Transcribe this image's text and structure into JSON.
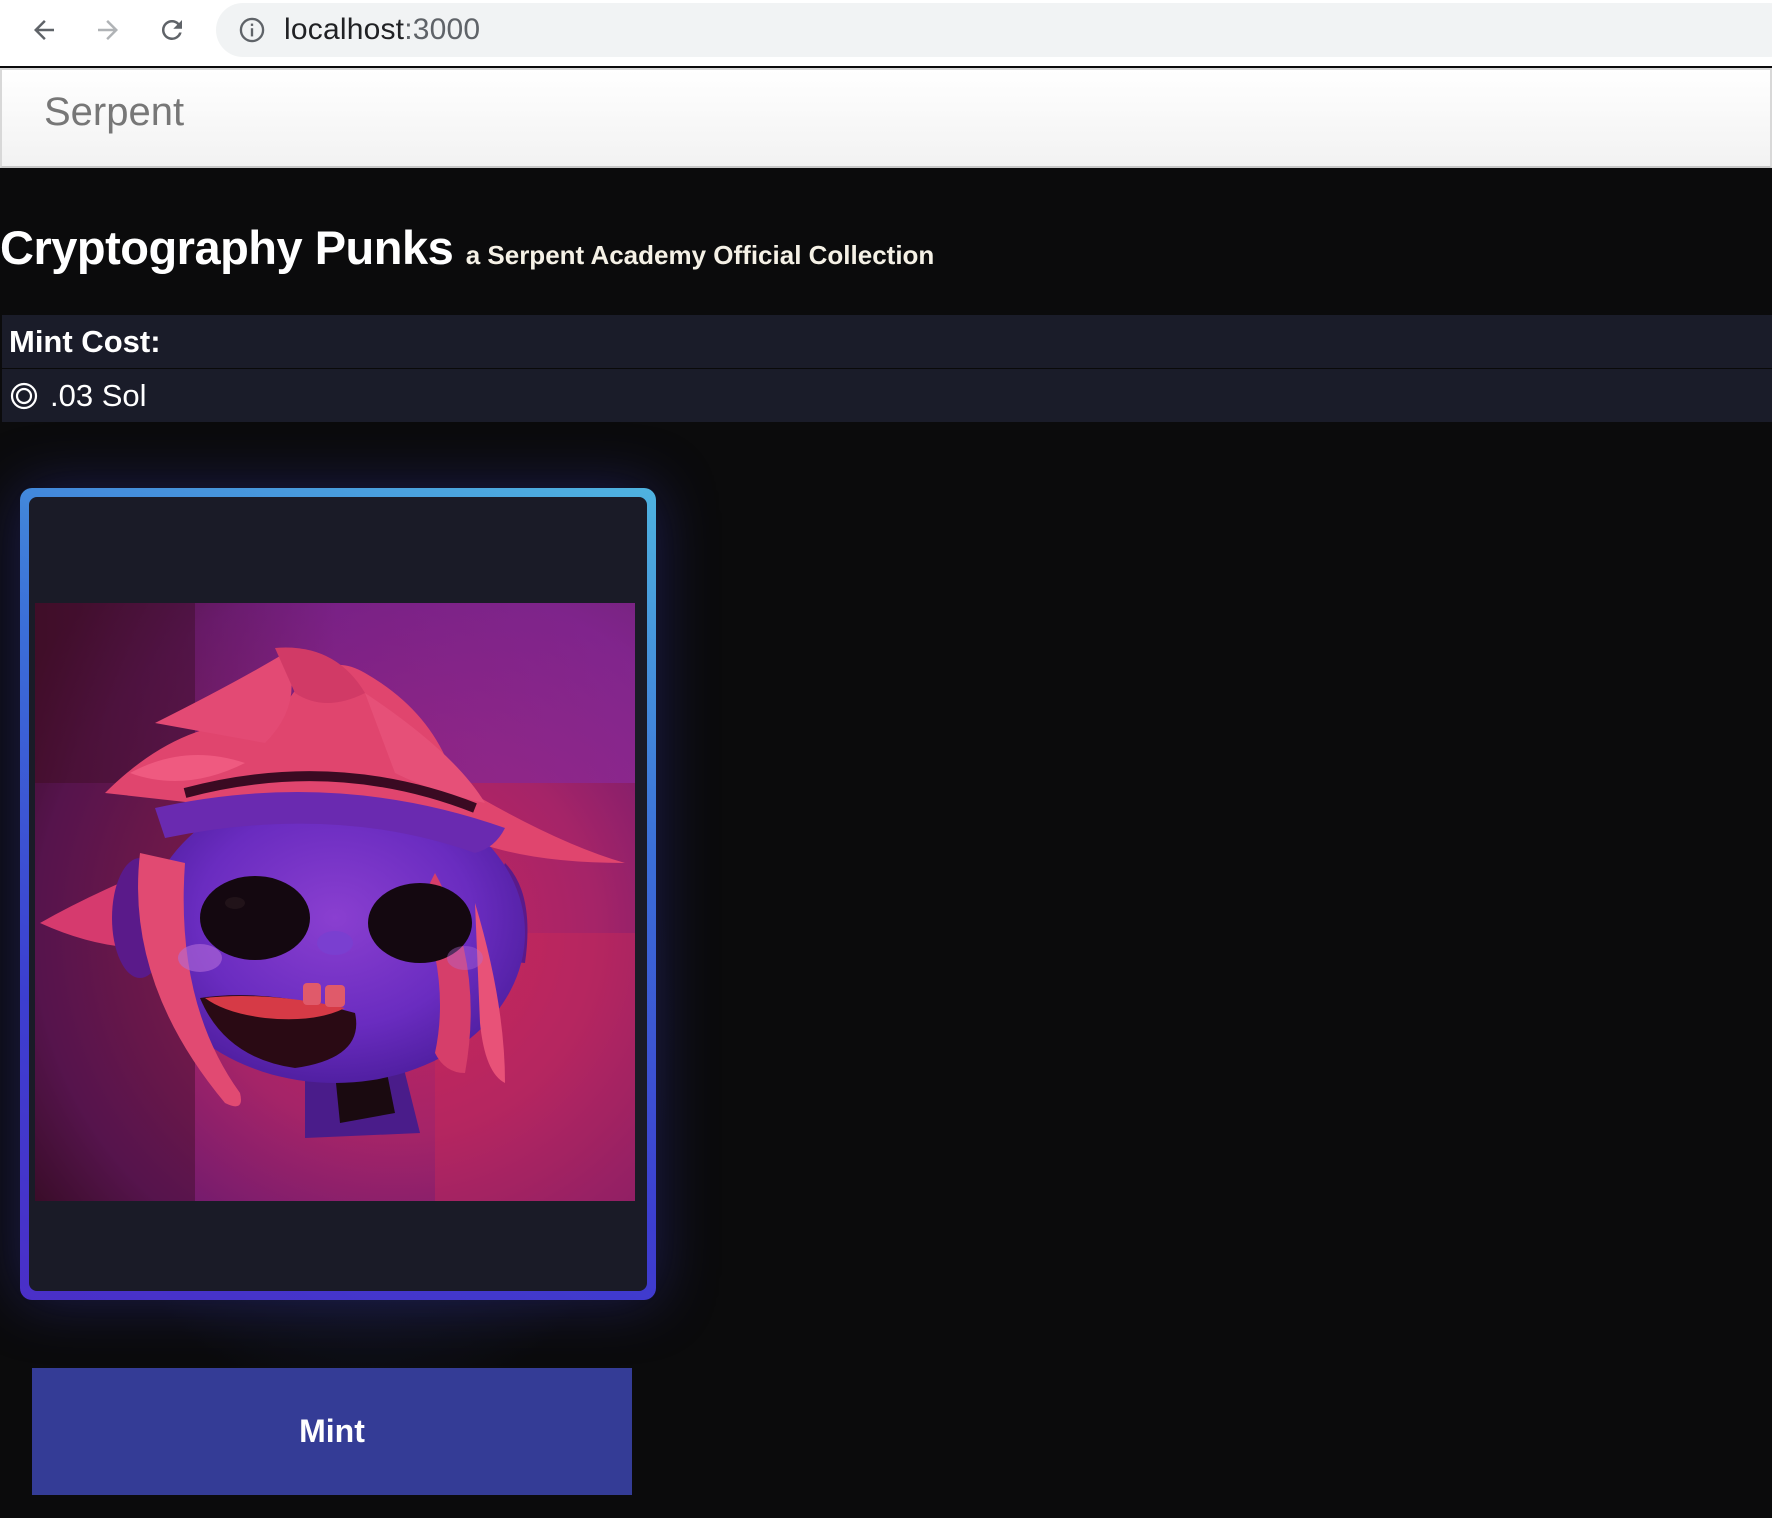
{
  "browser": {
    "url_host": "localhost",
    "url_port": ":3000",
    "back_icon": "arrow-left-icon",
    "forward_icon": "arrow-right-icon",
    "reload_icon": "reload-icon",
    "info_icon": "info-icon"
  },
  "navbar": {
    "brand": "Serpent"
  },
  "collection": {
    "title": "Cryptography Punks",
    "subtitle": "a Serpent Academy Official Collection"
  },
  "mint_cost": {
    "header": "Mint Cost:",
    "icon": "solana-coin-icon",
    "value": ".03 Sol"
  },
  "nft": {
    "description": "punk-portrait",
    "frame_colors": [
      "#4fb3e0",
      "#3b6fd8",
      "#4a2fc8"
    ]
  },
  "actions": {
    "mint_label": "Mint",
    "mint_color": "#343c96"
  }
}
